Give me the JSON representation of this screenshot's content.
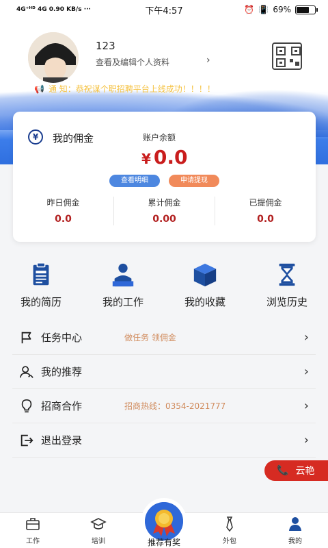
{
  "status_bar": {
    "network": "4G⁺ᴴᴰ 4G 0.90 KB/s ···",
    "time": "下午4:57",
    "battery_text": "69%",
    "battery_level": 0.69
  },
  "profile": {
    "username": "123",
    "edit_link": "查看及编辑个人资料",
    "notice_label": "通 知：",
    "notice_text": "恭祝谋个职招聘平台上线成功！！！！"
  },
  "commission": {
    "title": "我的佣金",
    "balance_label": "账户余额",
    "currency_symbol": "¥",
    "balance": "0.0",
    "view_detail_button": "查看明细",
    "withdraw_button": "申请提现",
    "stats": [
      {
        "label": "昨日佣金",
        "value": "0.0"
      },
      {
        "label": "累计佣金",
        "value": "0.00"
      },
      {
        "label": "已提佣金",
        "value": "0.0"
      }
    ]
  },
  "quick_links": [
    {
      "label": "我的简历",
      "icon": "resume-icon"
    },
    {
      "label": "我的工作",
      "icon": "worker-icon"
    },
    {
      "label": "我的收藏",
      "icon": "box-icon"
    },
    {
      "label": "浏览历史",
      "icon": "hourglass-icon"
    }
  ],
  "menu": [
    {
      "label": "任务中心",
      "hint": "做任务 领佣金",
      "icon": "flag-icon"
    },
    {
      "label": "我的推荐",
      "hint": "",
      "icon": "user-add-icon"
    },
    {
      "label": "招商合作",
      "hint": "招商热线：0354-2021777",
      "icon": "lightbulb-icon"
    },
    {
      "label": "退出登录",
      "hint": "",
      "icon": "logout-icon"
    }
  ],
  "call_button": "云艳",
  "tabbar": [
    {
      "label": "工作",
      "icon": "briefcase-icon"
    },
    {
      "label": "培训",
      "icon": "graduation-cap-icon"
    },
    {
      "label": "推荐有奖",
      "icon": "medal-icon"
    },
    {
      "label": "外包",
      "icon": "tie-icon"
    },
    {
      "label": "我的",
      "icon": "person-icon"
    }
  ],
  "colors": {
    "primary_blue": "#2f6fdf",
    "balance_red": "#c91d1d",
    "notice_yellow": "#f5c242",
    "hint_orange": "#d08a5b",
    "call_red": "#d62b22"
  }
}
